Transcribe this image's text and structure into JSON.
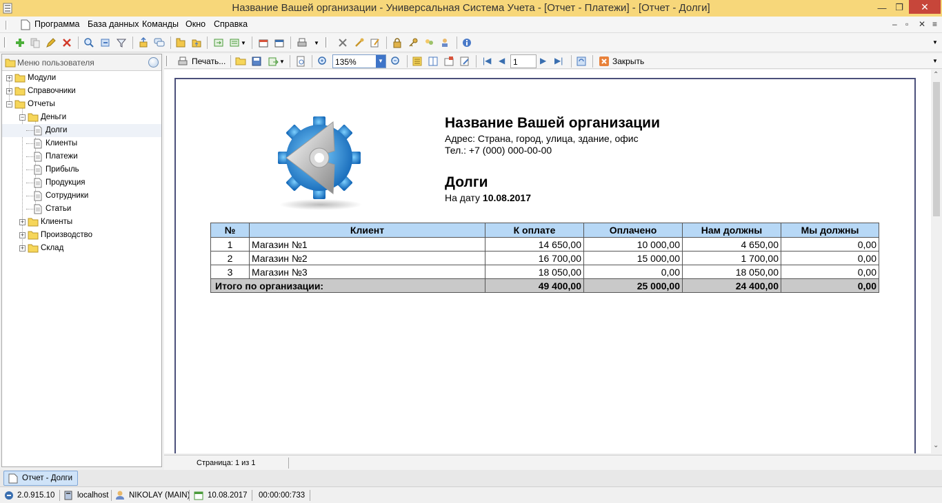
{
  "window": {
    "title": "Название Вашей организации - Универсальная Система Учета - [Отчет - Платежи] - [Отчет - Долги]"
  },
  "menu": {
    "items": [
      "Программа",
      "База данных",
      "Команды",
      "Окно",
      "Справка"
    ]
  },
  "sidebar": {
    "title": "Меню пользователя",
    "tree": [
      {
        "label": "Модули"
      },
      {
        "label": "Справочники"
      },
      {
        "label": "Отчеты"
      },
      {
        "label": "Деньги"
      },
      {
        "label": "Долги"
      },
      {
        "label": "Клиенты"
      },
      {
        "label": "Платежи"
      },
      {
        "label": "Прибыль"
      },
      {
        "label": "Продукция"
      },
      {
        "label": "Сотрудники"
      },
      {
        "label": "Статьи"
      },
      {
        "label": "Клиенты"
      },
      {
        "label": "Производство"
      },
      {
        "label": "Склад"
      }
    ]
  },
  "report_toolbar": {
    "print_label": "Печать...",
    "zoom": "135%",
    "page": "1",
    "close_label": "Закрыть"
  },
  "report": {
    "org_name": "Название Вашей организации",
    "address": "Адрес: Страна, город, улица, здание, офис",
    "phone": "Тел.: +7 (000) 000-00-00",
    "title": "Долги",
    "date_prefix": "На дату",
    "date": "10.08.2017",
    "columns": [
      "№",
      "Клиент",
      "К оплате",
      "Оплачено",
      "Нам должны",
      "Мы должны"
    ],
    "rows": [
      {
        "n": "1",
        "client": "Магазин №1",
        "to_pay": "14 650,00",
        "paid": "10 000,00",
        "owed_to_us": "4 650,00",
        "we_owe": "0,00"
      },
      {
        "n": "2",
        "client": "Магазин №2",
        "to_pay": "16 700,00",
        "paid": "15 000,00",
        "owed_to_us": "1 700,00",
        "we_owe": "0,00"
      },
      {
        "n": "3",
        "client": "Магазин №3",
        "to_pay": "18 050,00",
        "paid": "0,00",
        "owed_to_us": "18 050,00",
        "we_owe": "0,00"
      }
    ],
    "total": {
      "label": "Итого по организации:",
      "to_pay": "49 400,00",
      "paid": "25 000,00",
      "owed_to_us": "24 400,00",
      "we_owe": "0,00"
    }
  },
  "page_status": "Страница: 1 из 1",
  "tabs": [
    {
      "label": "Отчет - Долги"
    }
  ],
  "status": {
    "version": "2.0.915.10",
    "server": "localhost",
    "user": "NIKOLAY (MAIN)",
    "date": "10.08.2017",
    "timer": "00:00:00:733"
  },
  "colors": {
    "title_bar": "#f7d77a",
    "close_button": "#c7463a",
    "table_header": "#b7d8f6",
    "table_total": "#c9c9c9",
    "paper_border": "#4a4f7a"
  }
}
